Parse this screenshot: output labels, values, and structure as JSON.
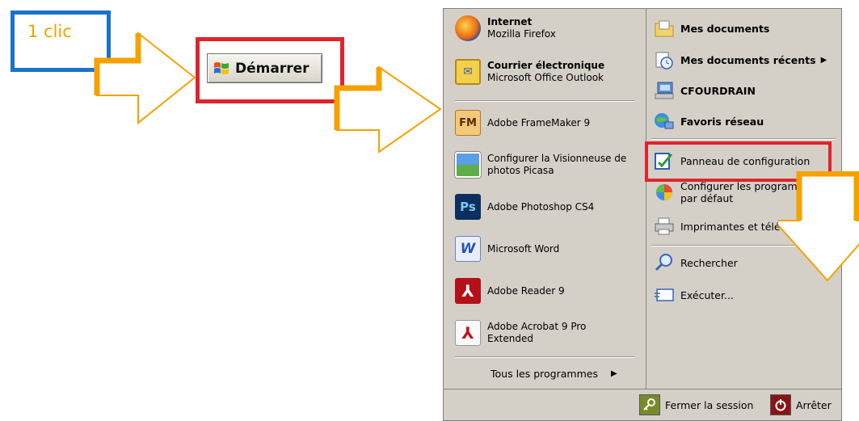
{
  "annotation": {
    "step_label": "1 clic"
  },
  "start_button": {
    "label": "Démarrer"
  },
  "start_menu": {
    "pinned": [
      {
        "title": "Internet",
        "subtitle": "Mozilla Firefox",
        "icon": "firefox-icon"
      },
      {
        "title": "Courrier électronique",
        "subtitle": "Microsoft Office Outlook",
        "icon": "outlook-icon"
      }
    ],
    "recent": [
      {
        "label": "Adobe FrameMaker 9",
        "icon": "framemaker-icon",
        "glyph": "FM"
      },
      {
        "label": "Configurer la Visionneuse de photos Picasa",
        "icon": "picasa-icon",
        "glyph": ""
      },
      {
        "label": "Adobe Photoshop CS4",
        "icon": "photoshop-icon",
        "glyph": "Ps"
      },
      {
        "label": "Microsoft Word",
        "icon": "word-icon",
        "glyph": "W"
      },
      {
        "label": "Adobe Reader 9",
        "icon": "adobe-reader-icon",
        "glyph": "⅄"
      },
      {
        "label": "Adobe Acrobat 9 Pro Extended",
        "icon": "acrobat-icon",
        "glyph": "⅄"
      }
    ],
    "all_programs": "Tous les programmes",
    "places": [
      {
        "label": "Mes documents",
        "icon": "my-documents-icon",
        "bold": true
      },
      {
        "label": "Mes documents récents",
        "icon": "recent-documents-icon",
        "bold": true
      },
      {
        "label": "CFOURDRAIN",
        "icon": "computer-icon",
        "bold": true
      },
      {
        "label": "Favoris réseau",
        "icon": "network-icon",
        "bold": true
      },
      {
        "label": "Panneau de configuration",
        "icon": "control-panel-icon",
        "bold": false
      },
      {
        "label": "Configurer les programmes par défaut",
        "icon": "default-programs-icon",
        "bold": false
      },
      {
        "label": "Imprimantes et télécopieurs",
        "icon": "printer-icon",
        "bold": false
      },
      {
        "label": "Rechercher",
        "icon": "search-icon",
        "bold": false
      },
      {
        "label": "Exécuter...",
        "icon": "run-icon",
        "bold": false
      }
    ],
    "logoff": "Fermer la session",
    "shutdown": "Arrêter"
  },
  "colors": {
    "arrow": "#f5a100",
    "highlight": "#e0242e",
    "step_box": "#1a73c8"
  }
}
